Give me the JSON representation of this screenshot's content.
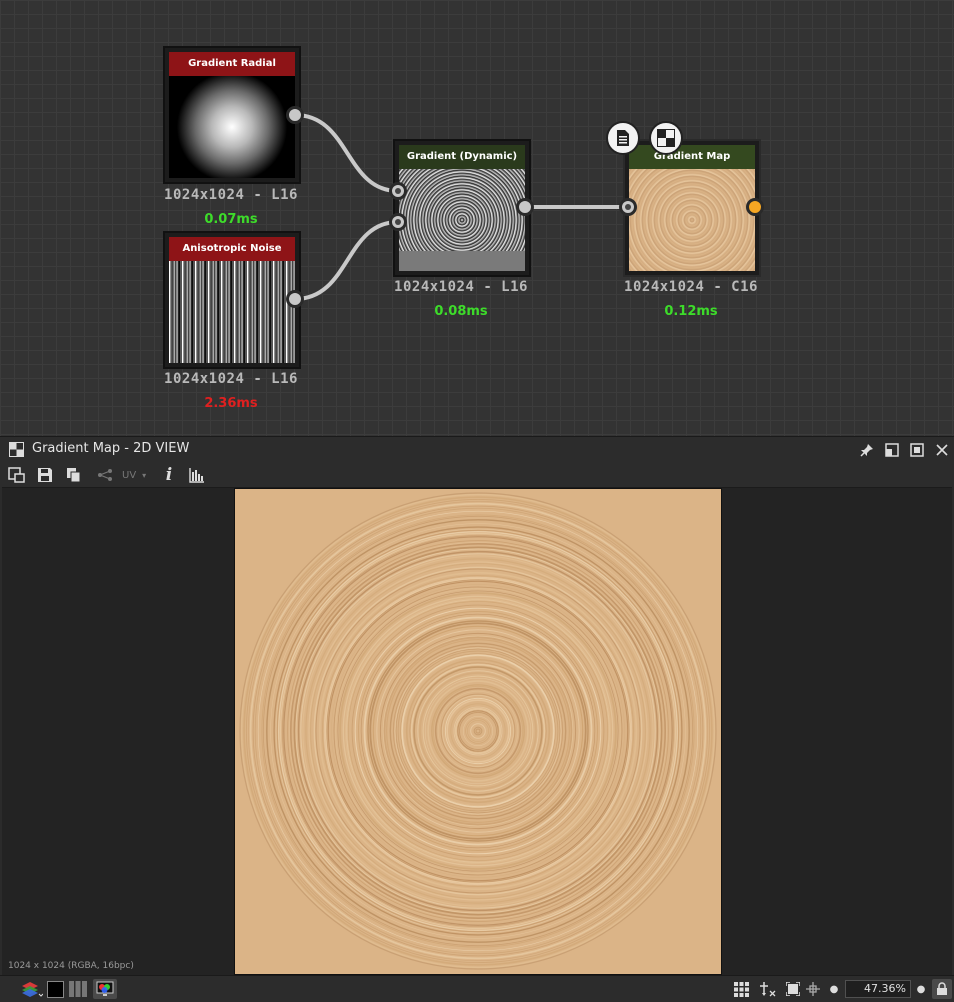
{
  "graph": {
    "nodes": [
      {
        "title": "Gradient Radial",
        "resolution": "1024x1024 - L16",
        "time": "0.07ms",
        "time_color": "#3ddc2a"
      },
      {
        "title": "Anisotropic Noise",
        "resolution": "1024x1024 - L16",
        "time": "2.36ms",
        "time_color": "#e02020"
      },
      {
        "title": "Gradient (Dynamic)",
        "resolution": "1024x1024 - L16",
        "time": "0.08ms",
        "time_color": "#3ddc2a"
      },
      {
        "title": "Gradient Map",
        "resolution": "1024x1024 - C16",
        "time": "0.12ms",
        "time_color": "#3ddc2a"
      }
    ],
    "badges": [
      "document-icon",
      "checker-icon"
    ]
  },
  "panel": {
    "title": "Gradient Map - 2D VIEW",
    "toolbar": {
      "uv_label": "UV"
    },
    "image_info": "1024 x 1024 (RGBA, 16bpc)",
    "zoom": "47.36%"
  },
  "colors": {
    "accent_orange": "#f5a623",
    "output_tint": "#dbb487"
  }
}
